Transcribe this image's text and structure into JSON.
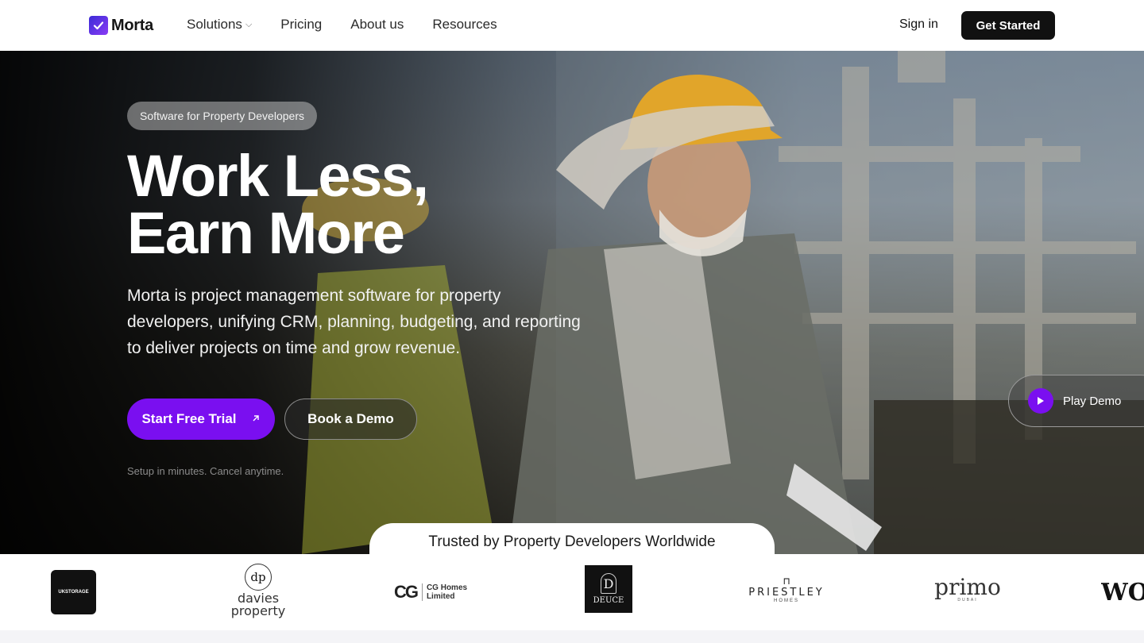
{
  "brand": {
    "name": "Morta",
    "accent": "#7a0ff0",
    "mark_icon": "check-icon"
  },
  "nav": {
    "links": [
      {
        "label": "Solutions",
        "has_dropdown": true
      },
      {
        "label": "Pricing"
      },
      {
        "label": "About us"
      },
      {
        "label": "Resources"
      }
    ],
    "signin_label": "Sign in",
    "get_started_label": "Get Started"
  },
  "hero": {
    "badge": "Software for Property Developers",
    "headline_line1": "Work Less,",
    "headline_line2": "Earn More",
    "subtext": "Morta is project management software for property developers, unifying CRM, planning, budgeting, and reporting to deliver projects on time and grow revenue.",
    "primary_cta": "Start Free Trial",
    "secondary_cta": "Book a Demo",
    "note": "Setup in minutes. Cancel anytime.",
    "play_demo": "Play Demo"
  },
  "trusted": {
    "heading": "Trusted by Property Developers Worldwide",
    "logos": [
      {
        "name": "UK Storage",
        "text": "UKSTORAGE"
      },
      {
        "name": "Davies Property",
        "text_line1": "davies",
        "text_line2": "property",
        "monogram": "dp"
      },
      {
        "name": "CG Homes Limited",
        "text_line1": "CG Homes",
        "text_line2": "Limited",
        "mark": "CG"
      },
      {
        "name": "Deuce",
        "text": "DEUCE",
        "monogram": "D"
      },
      {
        "name": "Priestley Homes",
        "text": "PRIESTLEY",
        "sub": "HOMES"
      },
      {
        "name": "Primo Dubai",
        "text": "primo",
        "sub": "DUBAI"
      },
      {
        "name": "Wo",
        "text": "WO"
      }
    ]
  }
}
